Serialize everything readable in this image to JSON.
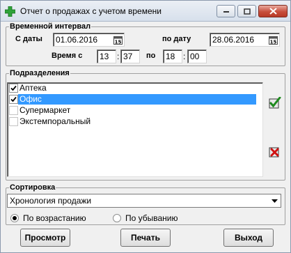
{
  "window": {
    "title": "Отчет о продажах с учетом времени"
  },
  "interval": {
    "legend": "Временной интервал",
    "date_from_label": "С даты",
    "date_from": "01.06.2016",
    "date_to_label": "по дату",
    "date_to": "28.06.2016",
    "time_from_label": "Время с",
    "time_from_h": "13",
    "time_from_m": "37",
    "time_to_label": "по",
    "time_to_h": "18",
    "time_to_m": "00",
    "colon": ":"
  },
  "departments": {
    "legend": "Подразделения",
    "items": [
      {
        "label": "Аптека",
        "checked": true,
        "selected": false
      },
      {
        "label": "Офис",
        "checked": true,
        "selected": true
      },
      {
        "label": "Супермаркет",
        "checked": false,
        "selected": false
      },
      {
        "label": "Экстемпоральный",
        "checked": false,
        "selected": false
      }
    ]
  },
  "sorting": {
    "legend": "Сортировка",
    "selected": "Хронология продажи",
    "asc_label": "По возрастанию",
    "desc_label": "По убыванию",
    "order": "asc"
  },
  "buttons": {
    "preview": "Просмотр",
    "print": "Печать",
    "exit": "Выход"
  },
  "colors": {
    "selection": "#3399ff",
    "check_green": "#1e8a1e",
    "uncheck_red": "#d01010"
  }
}
